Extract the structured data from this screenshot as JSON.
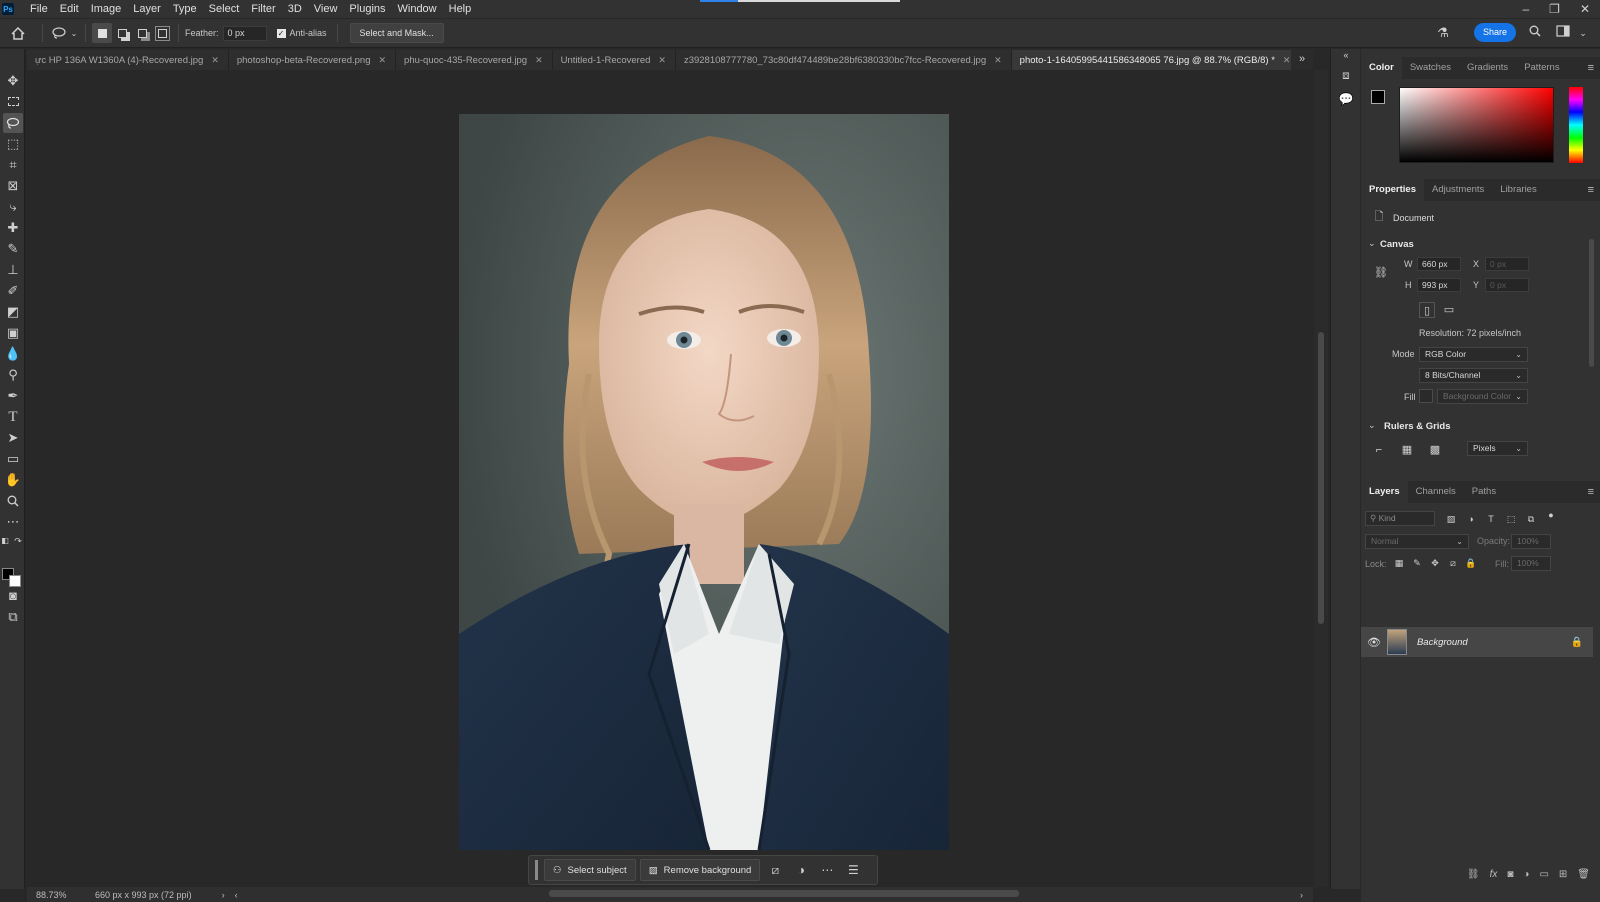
{
  "menubar": {
    "logo": "Ps",
    "items": [
      "File",
      "Edit",
      "Image",
      "Layer",
      "Type",
      "Select",
      "Filter",
      "3D",
      "View",
      "Plugins",
      "Window",
      "Help"
    ],
    "window_controls": {
      "minimize": "–",
      "restore": "❐",
      "close": "✕"
    }
  },
  "options": {
    "feather_label": "Feather:",
    "feather_value": "0 px",
    "antialias_label": "Anti-alias",
    "antialias_checked": true,
    "select_mask_label": "Select and Mask...",
    "share_label": "Share"
  },
  "tabs": [
    {
      "label": "ực HP 136A W1360A (4)-Recovered.jpg",
      "active": false
    },
    {
      "label": "photoshop-beta-Recovered.png",
      "active": false
    },
    {
      "label": "phu-quoc-435-Recovered.jpg",
      "active": false
    },
    {
      "label": "Untitled-1-Recovered",
      "active": false
    },
    {
      "label": "z3928108777780_73c80df474489be28bf6380330bc7fcc-Recovered.jpg",
      "active": false
    },
    {
      "label": "photo-1-16405995441586348065 76.jpg @ 88.7% (RGB/8) *",
      "active": true
    }
  ],
  "taskbar": {
    "select_subject": "Select subject",
    "remove_background": "Remove background"
  },
  "status": {
    "zoom": "88.73%",
    "doc_info": "660 px x 993 px (72 ppi)"
  },
  "color_panel": {
    "tabs": [
      "Color",
      "Swatches",
      "Gradients",
      "Patterns"
    ],
    "foreground": "#000000",
    "background": "#ffffff"
  },
  "properties_panel": {
    "tabs": [
      "Properties",
      "Adjustments",
      "Libraries"
    ],
    "doc_label": "Document",
    "canvas_heading": "Canvas",
    "w_label": "W",
    "w_value": "660 px",
    "h_label": "H",
    "h_value": "993 px",
    "x_label": "X",
    "x_value": "0 px",
    "y_label": "Y",
    "y_value": "0 px",
    "resolution": "Resolution: 72 pixels/inch",
    "mode_label": "Mode",
    "mode_value": "RGB Color",
    "bits_value": "8 Bits/Channel",
    "fill_label": "Fill",
    "fill_value": "Background Color",
    "rulers_heading": "Rulers & Grids",
    "units_value": "Pixels"
  },
  "layers_panel": {
    "tabs": [
      "Layers",
      "Channels",
      "Paths"
    ],
    "kind_placeholder": "Kind",
    "blend_mode": "Normal",
    "opacity_label": "Opacity:",
    "opacity_value": "100%",
    "lock_label": "Lock:",
    "fill_label": "Fill:",
    "fill_value": "100%",
    "layers": [
      {
        "name": "Background",
        "visible": true,
        "locked": true
      }
    ]
  }
}
